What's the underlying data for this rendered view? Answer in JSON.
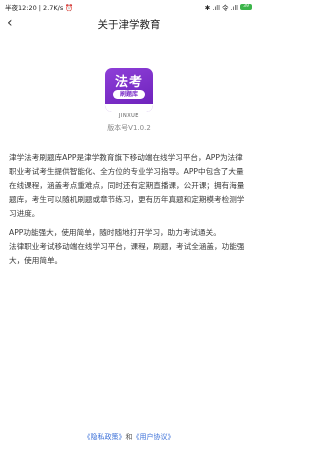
{
  "status_bar": {
    "time_speed": "半夜12:20 | 2.7K/s",
    "alarm_icon": "alarm-icon",
    "right_icons": "✱ .ıll 令 .ıll",
    "battery": "39"
  },
  "nav": {
    "back_icon": "‹",
    "title": "关于津学教育"
  },
  "app": {
    "logo_title": "法考",
    "logo_pill": "刷题库",
    "brand": "JINXUE",
    "version": "版本号V1.0.2",
    "colors": {
      "logo": "#7a2cc8"
    }
  },
  "description": {
    "para1": "津学法考刷题库APP是津学教育旗下移动端在线学习平台，APP为法律职业考试考生提供智能化、全方位的专业学习指导。APP中包含了大量在线课程，涵盖考点重难点，同时还有定期直播课，公开课；拥有海量题库，考生可以随机刷题或章节练习，更有历年真题和定期模考检测学习进度。",
    "para2": "APP功能强大，使用简单，随时随地打开学习，助力考试通关。",
    "para3": "法律职业考试移动端在线学习平台，课程，刷题，考试全涵盖，功能强大，使用简单。"
  },
  "footer": {
    "privacy": "《隐私政策》",
    "and": "和",
    "agreement": "《用户协议》"
  }
}
